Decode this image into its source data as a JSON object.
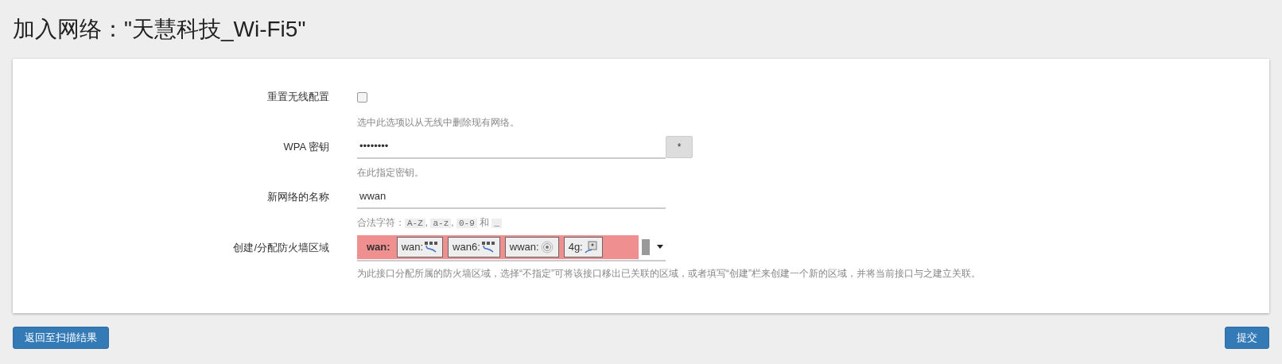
{
  "title": "加入网络：\"天慧科技_Wi-Fi5\"",
  "fields": [
    {
      "kind": "checkbox",
      "label": "重置无线配置",
      "checked": false,
      "hint": [
        {
          "kind": "text",
          "text": "选中此选项以从无线中删除现有网络。"
        }
      ]
    },
    {
      "kind": "password",
      "label": "WPA 密钥",
      "value": "••••••••",
      "button": "*",
      "hint": [
        {
          "kind": "text",
          "text": "在此指定密钥。"
        }
      ]
    },
    {
      "kind": "text",
      "label": "新网络的名称",
      "value": "wwan",
      "hint": [
        {
          "kind": "text",
          "text": "合法字符："
        },
        {
          "kind": "code",
          "text": "A-Z"
        },
        {
          "kind": "text",
          "text": ", "
        },
        {
          "kind": "code",
          "text": "a-z"
        },
        {
          "kind": "text",
          "text": ", "
        },
        {
          "kind": "code",
          "text": "0-9"
        },
        {
          "kind": "text",
          "text": " 和 "
        },
        {
          "kind": "code",
          "text": "_"
        }
      ]
    },
    {
      "kind": "zone",
      "label": "创建/分配防火墙区域",
      "zone": "wan:",
      "networks": [
        {
          "name": "wan:",
          "kind": "wired"
        },
        {
          "name": "wan6:",
          "kind": "wired"
        },
        {
          "name": "wwan:",
          "kind": "wireless"
        },
        {
          "name": "4g:",
          "kind": "modem"
        }
      ],
      "hint": [
        {
          "kind": "text",
          "text": "为此接口分配所属的防火墙区域，选择“不指定”可将该接口移出已关联的区域，或者填写“创建”栏来创建一个新的区域，并将当前接口与之建立关联。"
        }
      ]
    }
  ],
  "buttons": [
    "返回至扫描结果",
    "提交"
  ]
}
